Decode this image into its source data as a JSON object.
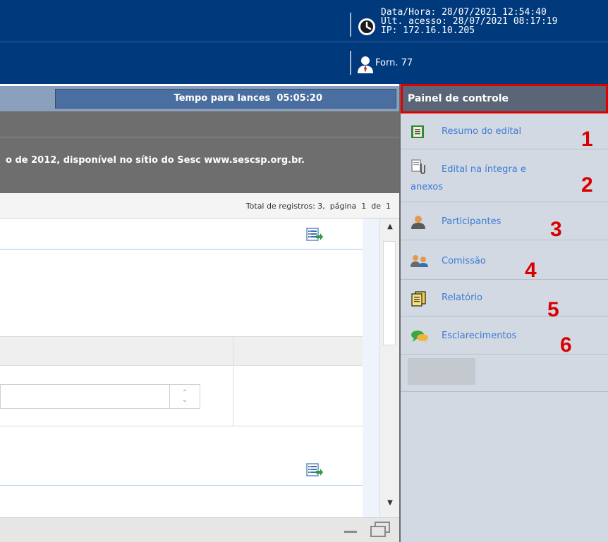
{
  "header": {
    "datetime": "Data/Hora: 28/07/2021 12:54:40",
    "last_access": "Últ. acesso: 28/07/2021 08:17:19",
    "ip": "IP: 172.16.10.205",
    "user": "Forn. 77"
  },
  "timer": {
    "label": "Tempo para lances  05:05:20"
  },
  "notice": {
    "text": "o de 2012, disponível no sítio do Sesc www.sescsp.org.br."
  },
  "records": {
    "text": "Total de registros: 3,  página  1  de  1"
  },
  "panel": {
    "title": "Painel de controle",
    "items": [
      {
        "label": "Resumo do edital",
        "number": "1",
        "icon": "summary-icon"
      },
      {
        "label_line1": "Edital na íntegra e",
        "label_line2": "anexos",
        "number": "2",
        "icon": "document-attachment-icon"
      },
      {
        "label": "Participantes",
        "number": "3",
        "icon": "person-icon"
      },
      {
        "label": "Comissão",
        "number": "4",
        "icon": "group-icon"
      },
      {
        "label": "Relatório",
        "number": "5",
        "icon": "report-icon"
      },
      {
        "label": "Esclarecimentos",
        "number": "6",
        "icon": "chat-icon"
      }
    ]
  },
  "colors": {
    "header_bg": "#003a7d",
    "panel_bg": "#d3d9e2",
    "link": "#3a7bd5",
    "highlight_red": "#e00000"
  }
}
